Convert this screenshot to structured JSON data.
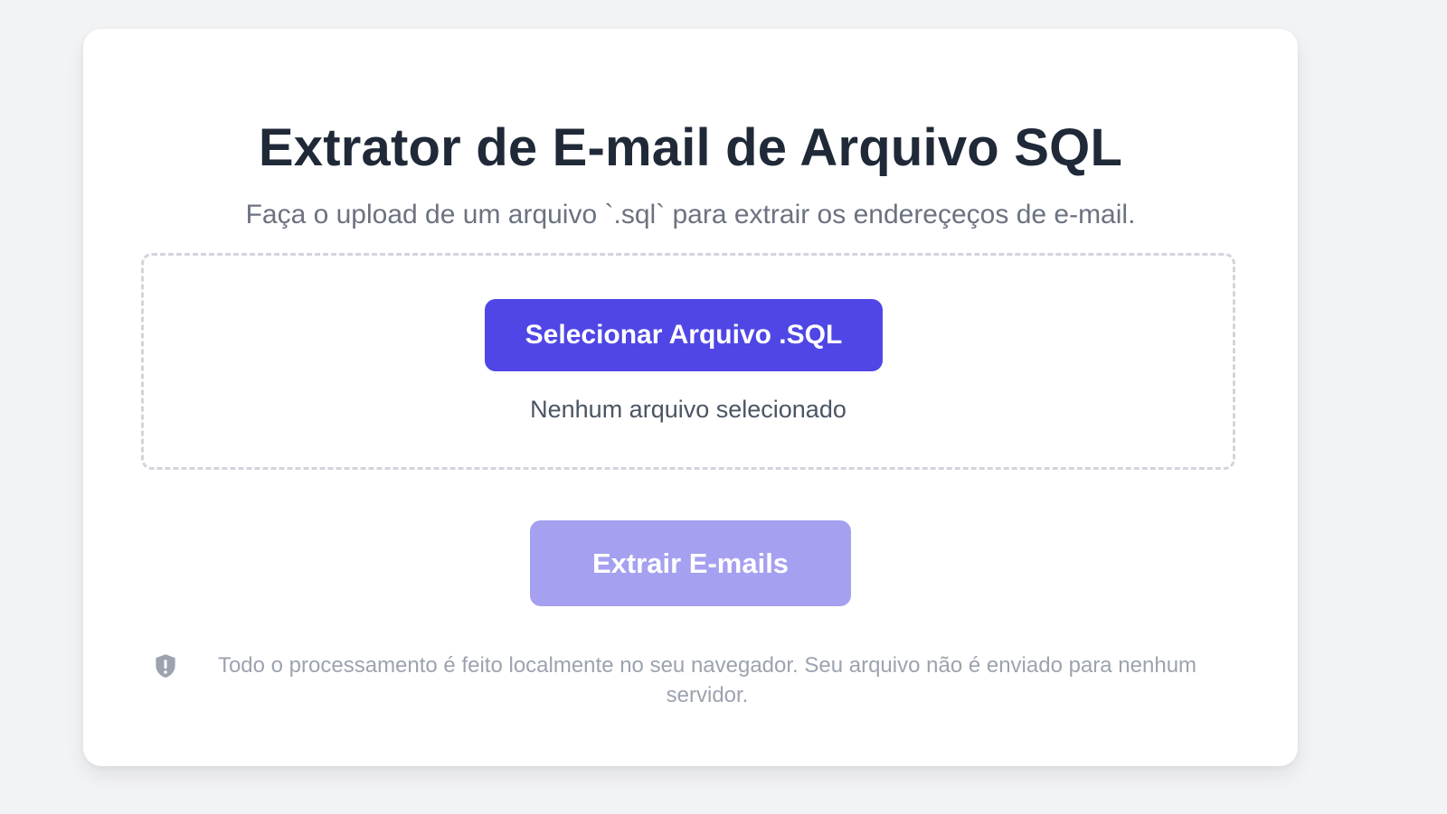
{
  "header": {
    "title": "Extrator de E-mail de Arquivo SQL",
    "subtitle": "Faça o upload de um arquivo `.sql` para extrair os endereçeços de e-mail."
  },
  "upload": {
    "select_label": "Selecionar Arquivo .SQL",
    "status_text": "Nenhum arquivo selecionado"
  },
  "actions": {
    "extract_label": "Extrair E-mails",
    "extract_enabled": false
  },
  "footer": {
    "privacy_icon": "shield-alert-icon",
    "privacy_note": "Todo o processamento é feito localmente no seu navegador. Seu arquivo não é enviado para nenhum servidor."
  },
  "colors": {
    "primary": "#4f46e5",
    "primary_disabled": "#a5a0f0",
    "title": "#1f2937",
    "subtitle": "#6b7280",
    "muted": "#9ca3af",
    "background": "#f2f3f5"
  }
}
